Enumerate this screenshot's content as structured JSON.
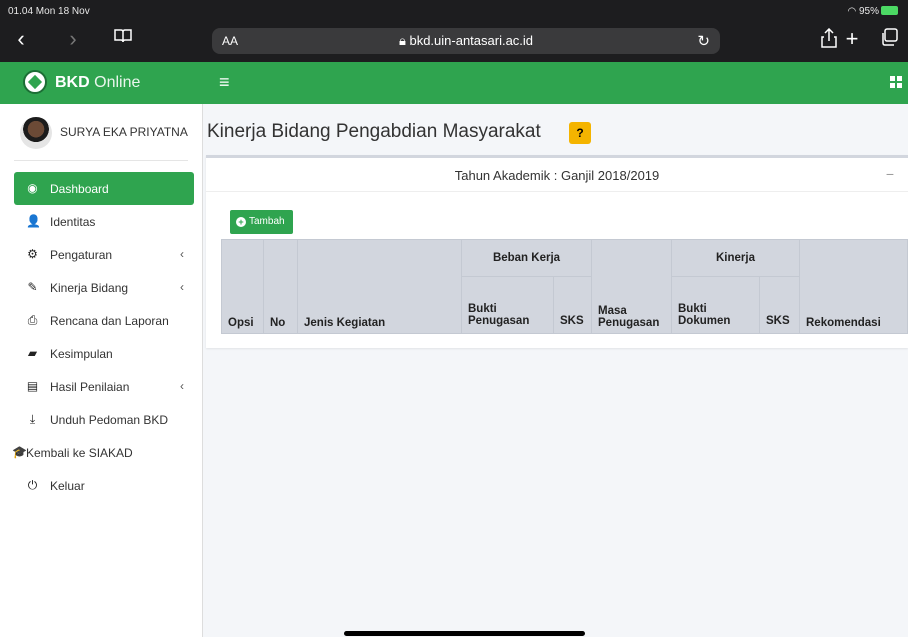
{
  "statusbar": {
    "time": "01.04  Mon 18 Nov",
    "battery": "95%"
  },
  "browser": {
    "text_size_label": "AA",
    "url": "bkd.uin-antasari.ac.id",
    "back_icon": "chevron-left-icon",
    "forward_icon": "chevron-right-icon",
    "bookmarks_icon": "book-icon",
    "reload_icon": "reload-icon",
    "share_icon": "share-icon",
    "newtab_icon": "plus-icon",
    "tabs_icon": "tabs-icon"
  },
  "app": {
    "brand_bold": "BKD",
    "brand_light": " Online",
    "accent_color": "#2fa44f"
  },
  "user": {
    "name": "SURYA EKA PRIYATNA"
  },
  "sidebar": {
    "items": [
      {
        "label": "Dashboard",
        "icon": "dashboard-icon",
        "glyph": "◉",
        "active": true,
        "arrow": ""
      },
      {
        "label": "Identitas",
        "icon": "user-icon",
        "glyph": "👤",
        "active": false,
        "arrow": ""
      },
      {
        "label": "Pengaturan",
        "icon": "gear-icon",
        "glyph": "⚙",
        "active": false,
        "arrow": "‹"
      },
      {
        "label": "Kinerja Bidang",
        "icon": "edit-icon",
        "glyph": "✎",
        "active": false,
        "arrow": "‹"
      },
      {
        "label": "Rencana dan Laporan",
        "icon": "print-icon",
        "glyph": "⎙",
        "active": false,
        "arrow": ""
      },
      {
        "label": "Kesimpulan",
        "icon": "book-icon",
        "glyph": "▰",
        "active": false,
        "arrow": ""
      },
      {
        "label": "Hasil Penilaian",
        "icon": "file-icon",
        "glyph": "▤",
        "active": false,
        "arrow": "‹"
      },
      {
        "label": "Unduh Pedoman BKD",
        "icon": "download-icon",
        "glyph": "⤓",
        "active": false,
        "arrow": ""
      },
      {
        "label": "Kembali ke SIAKAD",
        "icon": "graduation-cap-icon",
        "glyph": "🎓",
        "active": false,
        "arrow": ""
      },
      {
        "label": "Keluar",
        "icon": "power-icon",
        "glyph": "⏻",
        "active": false,
        "arrow": ""
      }
    ]
  },
  "main": {
    "title": "Kinerja Bidang Pengabdian Masyarakat",
    "help_label": "?",
    "card_title": "Tahun Akademik : Ganjil 2018/2019",
    "collapse_label": "−",
    "add_button": "Tambah",
    "table": {
      "group_headers": {
        "beban_kerja": "Beban Kerja",
        "kinerja": "Kinerja"
      },
      "columns": {
        "opsi": "Opsi",
        "no": "No",
        "jenis": "Jenis Kegiatan",
        "bukti_penugasan": "Bukti Penugasan",
        "sks1": "SKS",
        "masa_penugasan": "Masa Penugasan",
        "bukti_dokumen": "Bukti Dokumen",
        "sks2": "SKS",
        "rekomendasi": "Rekomendasi"
      },
      "rows": []
    }
  }
}
